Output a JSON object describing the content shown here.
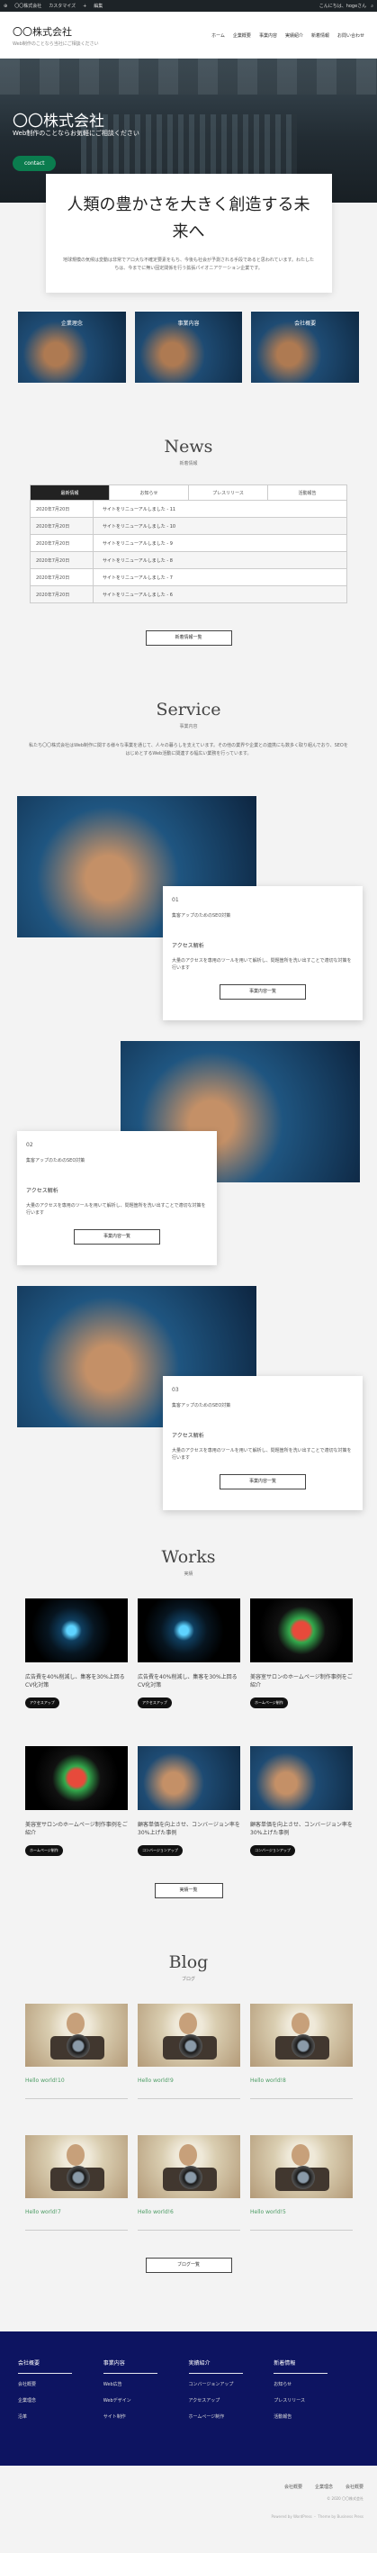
{
  "adminbar": {
    "items": [
      "〇〇株式会社",
      "カスタマイズ",
      "+",
      "編集"
    ],
    "right": [
      "こんにちは、hogeさん"
    ]
  },
  "header": {
    "title": "〇〇株式会社",
    "subtitle": "Web制作のことなら当社にご相談ください",
    "nav": [
      "ホーム",
      "企業概要",
      "事業内容",
      "実績紹介",
      "新着情報",
      "お問い合わせ"
    ]
  },
  "hero": {
    "title": "〇〇株式会社",
    "tagline": "Web制作のことならお気軽にご相談ください",
    "button": "contact"
  },
  "intro": {
    "heading": "人類の豊かさを大きく創造する未来へ",
    "body": "地球規模の気候は変動は非常でアロ大な不確定要素をもち、今後も社会が予測される手段であると思われています。わたしたちは、今までに無い固定関係を行う拡張パイオニアケーション企業です。"
  },
  "tiles": [
    "企業理念",
    "事業内容",
    "会社概要"
  ],
  "news": {
    "title": "News",
    "subtitle": "新着情報",
    "tabs": [
      "最新情報",
      "お知らせ",
      "プレスリリース",
      "活動報告"
    ],
    "rows": [
      {
        "date": "2020年7月20日",
        "title": "サイトをリニューアルしました - 11"
      },
      {
        "date": "2020年7月20日",
        "title": "サイトをリニューアルしました - 10"
      },
      {
        "date": "2020年7月20日",
        "title": "サイトをリニューアルしました - 9"
      },
      {
        "date": "2020年7月20日",
        "title": "サイトをリニューアルしました - 8"
      },
      {
        "date": "2020年7月20日",
        "title": "サイトをリニューアルしました - 7"
      },
      {
        "date": "2020年7月20日",
        "title": "サイトをリニューアルしました - 6"
      }
    ],
    "more": "新着情報一覧"
  },
  "service": {
    "title": "Service",
    "subtitle": "事業内容",
    "intro": "私たち〇〇株式会社はWeb制作に関する様々な事業を通じて、人々の暮らしを支えています。その他の業界や企業との連携にも数多く取り組んでおり、SEOをはじめとするWeb活動に関連する幅広い業務を行っています。",
    "cards": [
      {
        "no": "01",
        "small": "集客アップのためのSEO対策",
        "name": "アクセス解析",
        "desc": "大量のアクセスを専用のツールを用いて解析し、問題箇所を洗い出すことで適切な対策を行います",
        "more": "事業内容一覧"
      },
      {
        "no": "02",
        "small": "集客アップのためのSEO対策",
        "name": "アクセス解析",
        "desc": "大量のアクセスを専用のツールを用いて解析し、問題箇所を洗い出すことで適切な対策を行います",
        "more": "事業内容一覧"
      },
      {
        "no": "03",
        "small": "集客アップのためのSEO対策",
        "name": "アクセス解析",
        "desc": "大量のアクセスを専用のツールを用いて解析し、問題箇所を洗い出すことで適切な対策を行います",
        "more": "事業内容一覧"
      }
    ]
  },
  "works": {
    "title": "Works",
    "subtitle": "実績",
    "items": [
      {
        "text": "広告費を40%削減し、集客を30%上回るCV化対策",
        "badge": "アクセスアップ",
        "kind": "eye"
      },
      {
        "text": "広告費を40%削減し、集客を30%上回るCV化対策",
        "badge": "アクセスアップ",
        "kind": "eye"
      },
      {
        "text": "美容室サロンのホームページ制作事例をご紹介",
        "badge": "ホームページ制作",
        "kind": "phone"
      },
      {
        "text": "美容室サロンのホームページ制作事例をご紹介",
        "badge": "ホームページ制作",
        "kind": "phone"
      },
      {
        "text": "顧客単価を向上させ、コンバージョン率を30%上げた事例",
        "badge": "コンバージョンアップ",
        "kind": "robot"
      },
      {
        "text": "顧客単価を向上させ、コンバージョン率を30%上げた事例",
        "badge": "コンバージョンアップ",
        "kind": "robot"
      }
    ],
    "more": "実績一覧"
  },
  "blog": {
    "title": "Blog",
    "subtitle": "ブログ",
    "items": [
      "Hello world!10",
      "Hello world!9",
      "Hello world!8",
      "Hello world!7",
      "Hello world!6",
      "Hello world!5"
    ],
    "more": "ブログ一覧"
  },
  "footer": {
    "cols": [
      {
        "h": "会社概要",
        "links": [
          "会社概要",
          "企業理念",
          "沿革"
        ]
      },
      {
        "h": "事業内容",
        "links": [
          "Web広告",
          "Webデザイン",
          "サイト制作"
        ]
      },
      {
        "h": "実績紹介",
        "links": [
          "コンバージョンアップ",
          "アクセスアップ",
          "ホームページ制作"
        ]
      },
      {
        "h": "新着情報",
        "links": [
          "お知らせ",
          "プレスリリース",
          "活動報告"
        ]
      }
    ]
  },
  "subfooter": {
    "links": [
      "会社概要",
      "企業理念",
      "会社概要"
    ],
    "copy": "© 2020 〇〇株式会社",
    "credit": "Powered by WordPress ・ Theme by Business Press"
  }
}
